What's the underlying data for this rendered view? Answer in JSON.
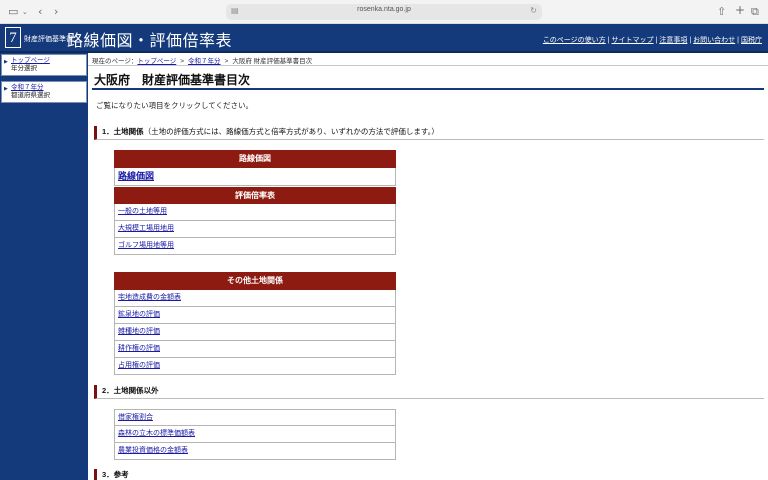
{
  "browser": {
    "url": "rosenka.nta.go.jp"
  },
  "header": {
    "logo_number": "7",
    "subtitle": "財産評価基準書",
    "title": "路線価図・評価倍率表",
    "nav": [
      "このページの使い方",
      "サイトマップ",
      "注意事項",
      "お問い合わせ",
      "国税庁"
    ]
  },
  "sidebar": {
    "items": [
      {
        "link": "トップページ",
        "sub": "年分選択"
      },
      {
        "link": "令和７年分",
        "sub": "都道府県選択"
      }
    ]
  },
  "breadcrumb": {
    "label": "現在のページ：",
    "items": [
      "トップページ",
      "令和７年分"
    ],
    "current": "大阪府 財産評価基準書目次"
  },
  "main": {
    "title": "大阪府　財産評価基準書目次",
    "intro": "ご覧になりたい項目をクリックしてください。",
    "sections": [
      {
        "title": "1．土地関係",
        "note": "（土地の評価方式には、路線価方式と倍率方式があり、いずれかの方法で評価します。）"
      },
      {
        "title": "2．土地関係以外",
        "note": ""
      },
      {
        "title": "3．参考",
        "note": ""
      }
    ],
    "rosenka": {
      "header": "路線価図",
      "link": "路線価図"
    },
    "bairitsu": {
      "header": "評価倍率表",
      "links": [
        "一般の土地等用",
        "大規模工場用地用",
        "ゴルフ場用地等用"
      ]
    },
    "other_land": {
      "header": "その他土地関係",
      "links": [
        "宅地造成費の金額表",
        "鉱泉地の評価",
        "雑種地の評価",
        "耕作権の評価",
        "占用権の評価"
      ]
    },
    "non_land": {
      "links": [
        "借家権割合",
        "森林の立木の標準価額表",
        "農業投資価格の金額表"
      ]
    }
  },
  "colors": {
    "header_bg": "#143a7c",
    "table_header": "#8e1b12",
    "link": "#1a1aa6"
  }
}
